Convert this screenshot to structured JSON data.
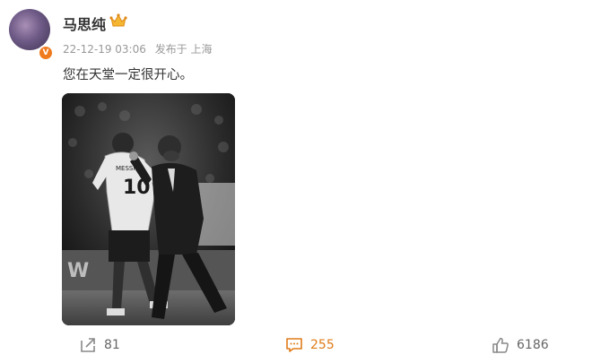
{
  "post": {
    "username": "马思纯",
    "verified_badge": "V",
    "timestamp": "22-12-19 03:06",
    "source": "发布于 上海",
    "text": "您在天堂一定很开心。"
  },
  "image": {
    "jersey_name": "MESSI",
    "jersey_number": "10"
  },
  "toolbar": {
    "repost_count": "81",
    "comment_count": "255",
    "like_count": "6186"
  },
  "colors": {
    "accent": "#f07a1e",
    "comment_active": "#e07b18",
    "text_primary": "#333333",
    "text_meta": "#999999"
  },
  "icons": [
    "crown-icon",
    "repost-icon",
    "comment-icon",
    "like-icon"
  ]
}
